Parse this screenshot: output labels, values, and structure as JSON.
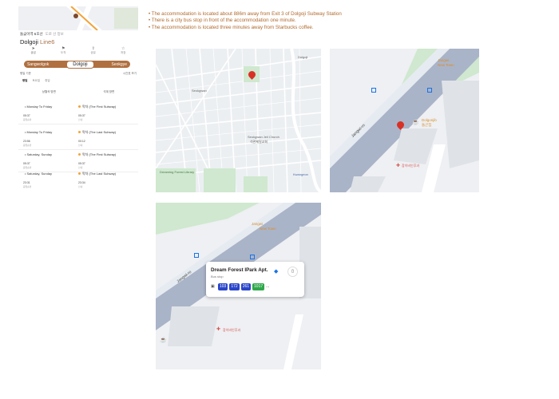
{
  "subway": {
    "station_kr": "돌곶이역 6호선",
    "station_sub": "도로 선 정보",
    "line_name_prefix": "Dolgoji",
    "line_name_suffix": "Line6",
    "actions": [
      {
        "label": "출발",
        "icon": "arrow-icon"
      },
      {
        "label": "도착",
        "icon": "flag-icon"
      },
      {
        "label": "공유",
        "icon": "share-icon"
      },
      {
        "label": "저장",
        "icon": "star-icon"
      }
    ],
    "direction": {
      "left": "Sangwolgok",
      "current": "Dolgoji",
      "right": "Seokgye"
    },
    "info_left": "평일 기준",
    "info_right": "시간표 보기",
    "tabs": [
      "평일",
      "토요일",
      "휴일"
    ],
    "col_left": "상월곡 방면",
    "col_right": "석계 방면",
    "schedule": [
      {
        "left_label": "• Monday To Friday",
        "right_label": "막차 (The First Subway)",
        "left_time": "05:37",
        "right_time": "05:37",
        "left_dir": "응암순환",
        "right_dir": "신내"
      },
      {
        "left_label": "• Monday To Friday",
        "right_label": "막차 (The Last Subway)",
        "left_time": "23:56",
        "right_time": "00:12",
        "left_dir": "응암순환",
        "right_dir": "신내"
      },
      {
        "left_label": "• Saturday, Sunday",
        "right_label": "막차 (The First Subway)",
        "left_time": "05:37",
        "right_time": "05:37",
        "left_dir": "응암순환",
        "right_dir": "신내"
      },
      {
        "left_label": "• Saturday, Sunday",
        "right_label": "막차 (The Last Subway)",
        "left_time": "23:31",
        "right_time": "23:34",
        "left_dir": "응암순환",
        "right_dir": "신내"
      }
    ]
  },
  "notes": [
    "• The accommodation is located about 886m away from Exit 3 of Dolgoji Subway Station",
    "• There is a city bus stop in front of the accommodation one minute.",
    "• The accommodation is located three minutes away from Starbucks coffee."
  ],
  "map1": {
    "labels": [
      "Dolgoji",
      "Seokgwan Jeil Church",
      "석관제일교회",
      "Seokgwan",
      "Dreaming Forest Library",
      "Kwangeon"
    ]
  },
  "map2": {
    "labels": [
      "Dolgonjib",
      "돌곤집",
      "Jangwi-ro",
      "참이비인후과",
      "Jangwi",
      "New Town"
    ]
  },
  "map3": {
    "labels": [
      "Jangwi-ro",
      "참이비인후과",
      "Jangwi",
      "New Town"
    ]
  },
  "bus_card": {
    "title": "Dream Forest IPark Apt.",
    "subtitle": "Bus stop",
    "buses": [
      "103",
      "172",
      "261",
      "1017"
    ],
    "more": "..."
  },
  "colors": {
    "accent": "#b07040",
    "note_text": "#b06a2e",
    "pin": "#d93025",
    "bus_blue": "#2a46c9",
    "bus_green": "#2ea84a"
  }
}
